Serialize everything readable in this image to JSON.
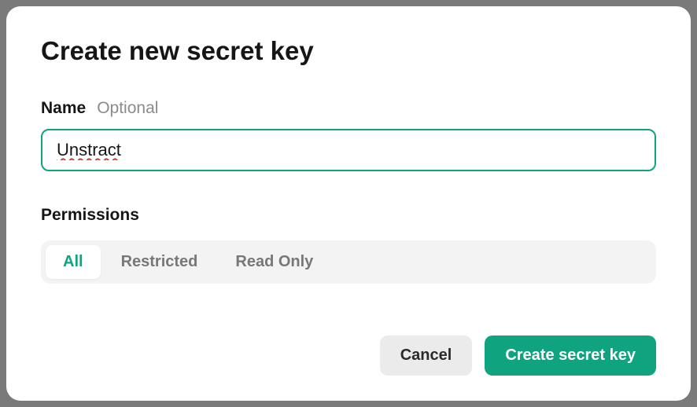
{
  "modal": {
    "title": "Create new secret key",
    "nameField": {
      "label": "Name",
      "hint": "Optional",
      "value": "Unstract"
    },
    "permissions": {
      "label": "Permissions",
      "options": [
        "All",
        "Restricted",
        "Read Only"
      ],
      "selected": "All"
    },
    "buttons": {
      "cancel": "Cancel",
      "submit": "Create secret key"
    }
  },
  "colors": {
    "accent": "#10a37f",
    "text": "#161616",
    "muted": "#8b8b8b",
    "segmentBg": "#f3f3f3",
    "secondaryBtn": "#ebebeb",
    "overlay": "#7a7a7a"
  }
}
